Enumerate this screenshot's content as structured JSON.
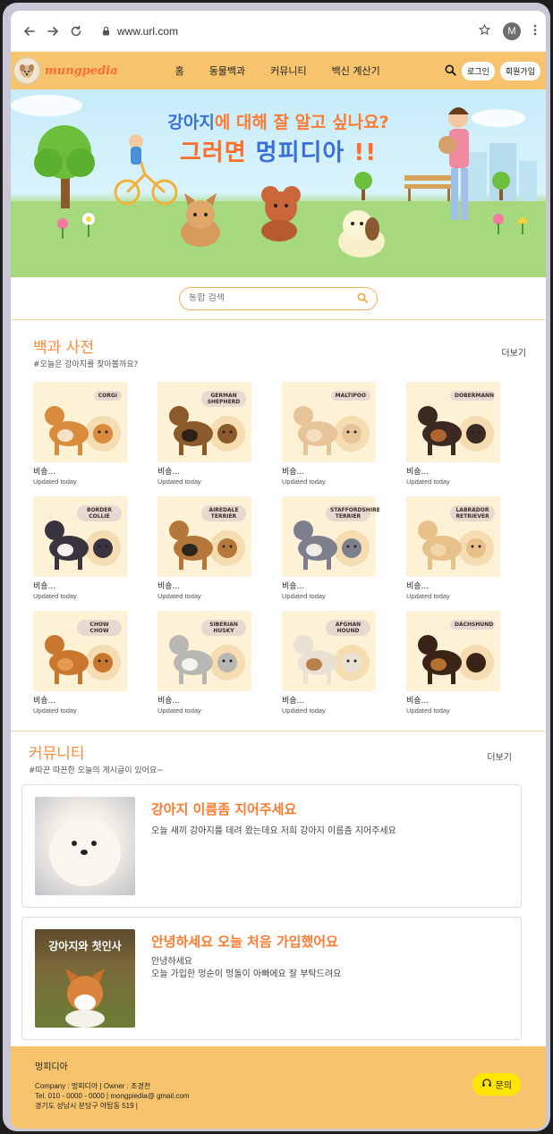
{
  "browser": {
    "url": "www.url.com",
    "profile_initial": "M",
    "icons": [
      "back-arrow-icon",
      "forward-arrow-icon",
      "reload-icon",
      "lock-icon",
      "star-icon",
      "more-vertical-icon"
    ]
  },
  "header": {
    "logo_text": "mungpedia",
    "nav": [
      "홈",
      "동물백과",
      "커뮤니티",
      "백신 계산기"
    ],
    "login_label": "로그인",
    "signup_label": "회원가입"
  },
  "hero": {
    "line1_part1": "강아지",
    "line1_part2": "에 대해 잘 알고 싶나요?",
    "line2_part1": "그러면 ",
    "line2_part2": "멍피디아",
    "line2_part3": " !!"
  },
  "search": {
    "placeholder": "통합 검색"
  },
  "encyclopedia": {
    "title": "백과 사전",
    "subtitle": "#오늘은 강아지를 찾아볼까요?",
    "more_label": "더보기",
    "cards": [
      {
        "tag": "CORGI",
        "title": "비숑...",
        "date": "Updated today"
      },
      {
        "tag": "GERMAN SHEPHERD",
        "title": "비숑...",
        "date": "Updated today"
      },
      {
        "tag": "MALTIPOO",
        "title": "비숑...",
        "date": "Updated today"
      },
      {
        "tag": "DOBERMANN",
        "title": "비숑...",
        "date": "Updated today"
      },
      {
        "tag": "BORDER COLLIE",
        "title": "비숑...",
        "date": "Updated today"
      },
      {
        "tag": "AIREDALE TERRIER",
        "title": "비숑...",
        "date": "Updated today"
      },
      {
        "tag": "STAFFORDSHIRE TERRIER",
        "title": "비숑...",
        "date": "Updated today"
      },
      {
        "tag": "LABRADOR RETRIEVER",
        "title": "비숑...",
        "date": "Updated today"
      },
      {
        "tag": "CHOW CHOW",
        "title": "비숑...",
        "date": "Updated today"
      },
      {
        "tag": "SIBERIAN HUSKY",
        "title": "비숑...",
        "date": "Updated today"
      },
      {
        "tag": "AFGHAN HOUND",
        "title": "비숑...",
        "date": "Updated today"
      },
      {
        "tag": "DACHSHUND",
        "title": "비숑...",
        "date": "Updated today"
      }
    ]
  },
  "community": {
    "title": "커뮤니티",
    "subtitle": "#따끈 따끈한 오늘의 게시글이 있어요~",
    "more_label": "더보기",
    "posts": [
      {
        "title": "강아지 이름좀 지어주세요",
        "body": "오늘 새끼 강아지를 데려 왔는데요 저희 강아지 이름좀 지어주세요",
        "image_caption": ""
      },
      {
        "title": "안녕하세요 오늘 처음 가입했어요",
        "body": "안녕하세요\n오늘 가입한 멍순이 멍돌이 아빠에요 잘 부탁드려요",
        "image_caption": "강아지와 첫인사"
      }
    ]
  },
  "footer": {
    "brand": "멍피디아",
    "line1": "Company : 멍피디아 | Owner : 조경천",
    "line2": "Tel. 010 - 0000 - 0000 | mongpiedia@ gmail.com",
    "line3": "경기도 성남시 분당구 야탑동 519 |",
    "contact_label": "문의"
  },
  "colors": {
    "brand_yellow": "#f7c46d",
    "accent_orange": "#ff7a2f",
    "accent_blue": "#3a6fd8",
    "card_bg": "#fdf1d6",
    "contact_yellow": "#ffe600"
  }
}
